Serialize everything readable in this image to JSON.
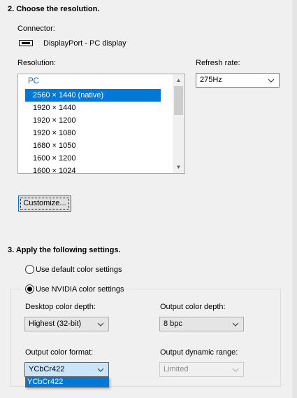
{
  "section2": {
    "title": "2. Choose the resolution.",
    "connector_label": "Connector:",
    "connector_value": "DisplayPort - PC display",
    "resolution_label": "Resolution:",
    "refresh_label": "Refresh rate:",
    "refresh_value": "275Hz",
    "list_group": "PC",
    "resolutions": [
      "2560 × 1440 (native)",
      "1920 × 1440",
      "1920 × 1200",
      "1920 × 1080",
      "1680 × 1050",
      "1600 × 1200",
      "1600 × 1024"
    ],
    "customize_label": "Customize..."
  },
  "section3": {
    "title": "3. Apply the following settings.",
    "radio_default": "Use default color settings",
    "radio_nvidia": "Use NVIDIA color settings",
    "desktop_depth_label": "Desktop color depth:",
    "desktop_depth_value": "Highest (32-bit)",
    "output_depth_label": "Output color depth:",
    "output_depth_value": "8 bpc",
    "output_format_label": "Output color format:",
    "output_format_value": "YCbCr422",
    "output_range_label": "Output dynamic range:",
    "output_range_value": "Limited",
    "dropdown_option": "YCbCr422"
  }
}
